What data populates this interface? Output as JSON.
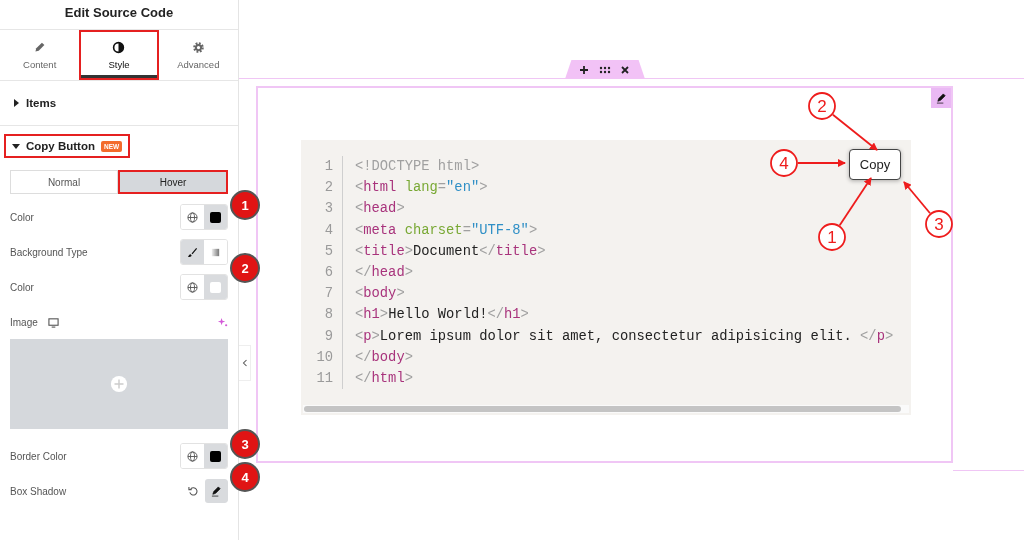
{
  "panel": {
    "title": "Edit Source Code",
    "tabs": [
      {
        "label": "Content",
        "kind": "pencil",
        "selected": false,
        "highlighted": false
      },
      {
        "label": "Style",
        "kind": "contrast",
        "selected": true,
        "highlighted": true
      },
      {
        "label": "Advanced",
        "kind": "gear",
        "selected": false,
        "highlighted": false
      }
    ],
    "sections": [
      {
        "label": "Items",
        "expanded": false,
        "highlighted": false
      },
      {
        "label": "Copy Button",
        "badge": "NEW",
        "expanded": true,
        "highlighted": true
      }
    ],
    "state_tabs": [
      {
        "label": "Normal",
        "selected": false,
        "highlighted": false
      },
      {
        "label": "Hover",
        "selected": true,
        "highlighted": true
      }
    ],
    "controls": [
      {
        "kind": "color",
        "label": "Color",
        "color": "#000000",
        "marker": "1"
      },
      {
        "kind": "choose",
        "label": "Background Type",
        "marker": "2"
      },
      {
        "kind": "color",
        "label": "Color",
        "color": "#ffffff"
      },
      {
        "kind": "image",
        "label": "Image"
      },
      {
        "kind": "color",
        "label": "Border Color",
        "color": "#000000",
        "marker": "3"
      },
      {
        "kind": "shadow",
        "label": "Box Shadow",
        "marker": "4"
      }
    ]
  },
  "canvas": {
    "code_lines": [
      {
        "number": "1",
        "tokens": [
          {
            "kind": "punct",
            "text": "<!DOCTYPE html>"
          }
        ]
      },
      {
        "number": "2",
        "tokens": [
          {
            "kind": "punct",
            "text": "<"
          },
          {
            "kind": "tag",
            "text": "html"
          },
          {
            "kind": "attr",
            "text": " lang"
          },
          {
            "kind": "punct",
            "text": "="
          },
          {
            "kind": "value",
            "text": "\"en\""
          },
          {
            "kind": "punct",
            "text": ">"
          }
        ]
      },
      {
        "number": "3",
        "tokens": [
          {
            "kind": "punct",
            "text": "<"
          },
          {
            "kind": "tag",
            "text": "head"
          },
          {
            "kind": "punct",
            "text": ">"
          }
        ]
      },
      {
        "number": "4",
        "tokens": [
          {
            "kind": "punct",
            "text": "<"
          },
          {
            "kind": "tag",
            "text": "meta"
          },
          {
            "kind": "attr",
            "text": " charset"
          },
          {
            "kind": "punct",
            "text": "="
          },
          {
            "kind": "value",
            "text": "\"UTF-8\""
          },
          {
            "kind": "punct",
            "text": ">"
          }
        ]
      },
      {
        "number": "5",
        "tokens": [
          {
            "kind": "punct",
            "text": "<"
          },
          {
            "kind": "tag",
            "text": "title"
          },
          {
            "kind": "punct",
            "text": ">"
          },
          {
            "kind": "text",
            "text": "Document"
          },
          {
            "kind": "punct",
            "text": "</"
          },
          {
            "kind": "tag",
            "text": "title"
          },
          {
            "kind": "punct",
            "text": ">"
          }
        ]
      },
      {
        "number": "6",
        "tokens": [
          {
            "kind": "punct",
            "text": "</"
          },
          {
            "kind": "tag",
            "text": "head"
          },
          {
            "kind": "punct",
            "text": ">"
          }
        ]
      },
      {
        "number": "7",
        "tokens": [
          {
            "kind": "punct",
            "text": "<"
          },
          {
            "kind": "tag",
            "text": "body"
          },
          {
            "kind": "punct",
            "text": ">"
          }
        ]
      },
      {
        "number": "8",
        "tokens": [
          {
            "kind": "punct",
            "text": "<"
          },
          {
            "kind": "tag",
            "text": "h1"
          },
          {
            "kind": "punct",
            "text": ">"
          },
          {
            "kind": "text",
            "text": "Hello World!"
          },
          {
            "kind": "punct",
            "text": "</"
          },
          {
            "kind": "tag",
            "text": "h1"
          },
          {
            "kind": "punct",
            "text": ">"
          }
        ]
      },
      {
        "number": "9",
        "tokens": [
          {
            "kind": "punct",
            "text": "<"
          },
          {
            "kind": "tag",
            "text": "p"
          },
          {
            "kind": "punct",
            "text": ">"
          },
          {
            "kind": "text",
            "text": "Lorem ipsum dolor sit amet, consectetur adipisicing elit. "
          },
          {
            "kind": "punct",
            "text": "</"
          },
          {
            "kind": "tag",
            "text": "p"
          },
          {
            "kind": "punct",
            "text": ">"
          }
        ]
      },
      {
        "number": "10",
        "tokens": [
          {
            "kind": "punct",
            "text": "</"
          },
          {
            "kind": "tag",
            "text": "body"
          },
          {
            "kind": "punct",
            "text": ">"
          }
        ]
      },
      {
        "number": "11",
        "tokens": [
          {
            "kind": "punct",
            "text": "</"
          },
          {
            "kind": "tag",
            "text": "html"
          },
          {
            "kind": "punct",
            "text": ">"
          }
        ]
      }
    ],
    "copy_button": "Copy",
    "callouts": [
      {
        "label": "2"
      },
      {
        "label": "4"
      },
      {
        "label": "1"
      },
      {
        "label": "3"
      }
    ]
  }
}
